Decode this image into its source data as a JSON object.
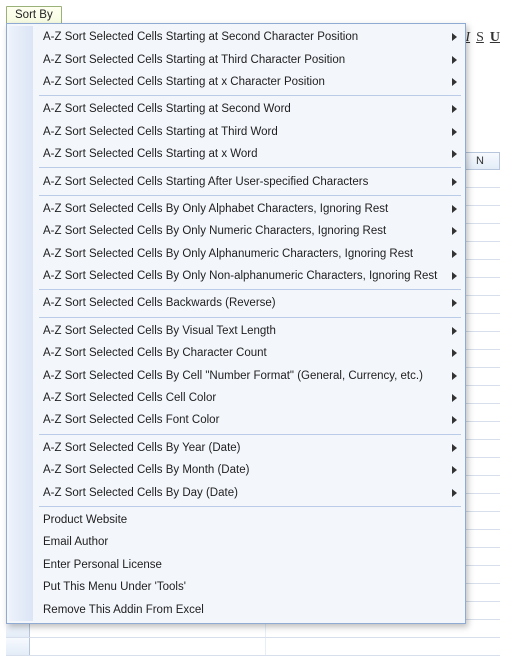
{
  "menu": {
    "button_label": "Sort By",
    "groups": [
      [
        {
          "label": "A-Z Sort Selected Cells Starting at Second Character Position",
          "submenu": true
        },
        {
          "label": "A-Z Sort Selected Cells Starting at Third Character Position",
          "submenu": true
        },
        {
          "label": "A-Z Sort Selected Cells Starting at x Character Position",
          "submenu": true
        }
      ],
      [
        {
          "label": "A-Z Sort Selected Cells Starting at Second Word",
          "submenu": true
        },
        {
          "label": "A-Z Sort Selected Cells Starting at Third Word",
          "submenu": true
        },
        {
          "label": "A-Z Sort Selected Cells Starting at x Word",
          "submenu": true
        }
      ],
      [
        {
          "label": "A-Z Sort Selected Cells Starting After User-specified Characters",
          "submenu": true
        }
      ],
      [
        {
          "label": "A-Z Sort Selected Cells By Only Alphabet Characters, Ignoring Rest",
          "submenu": true
        },
        {
          "label": "A-Z Sort Selected Cells By Only Numeric Characters, Ignoring Rest",
          "submenu": true
        },
        {
          "label": "A-Z Sort Selected Cells By Only Alphanumeric Characters, Ignoring Rest",
          "submenu": true
        },
        {
          "label": "A-Z Sort Selected Cells By Only Non-alphanumeric Characters, Ignoring Rest",
          "submenu": true
        }
      ],
      [
        {
          "label": "A-Z Sort Selected Cells Backwards (Reverse)",
          "submenu": true
        }
      ],
      [
        {
          "label": "A-Z Sort Selected Cells By Visual Text Length",
          "submenu": true
        },
        {
          "label": "A-Z Sort Selected Cells By Character Count",
          "submenu": true
        },
        {
          "label": "A-Z Sort Selected Cells By Cell \"Number Format\" (General, Currency, etc.)",
          "submenu": true
        },
        {
          "label": "A-Z Sort Selected Cells Cell Color",
          "submenu": true
        },
        {
          "label": "A-Z Sort Selected Cells Font Color",
          "submenu": true
        }
      ],
      [
        {
          "label": "A-Z Sort Selected Cells By Year (Date)",
          "submenu": true
        },
        {
          "label": "A-Z Sort Selected Cells By Month (Date)",
          "submenu": true
        },
        {
          "label": "A-Z Sort Selected Cells By Day (Date)",
          "submenu": true
        }
      ],
      [
        {
          "label": "Product Website",
          "submenu": false
        },
        {
          "label": "Email Author",
          "submenu": false
        },
        {
          "label": "Enter Personal License",
          "submenu": false
        },
        {
          "label": "Put This Menu Under 'Tools'",
          "submenu": false
        },
        {
          "label": "Remove This Addin From Excel",
          "submenu": false
        }
      ]
    ]
  },
  "sheet": {
    "visible_column_label": "N",
    "toolbar_glyphs": [
      "I",
      "S",
      "U"
    ]
  }
}
